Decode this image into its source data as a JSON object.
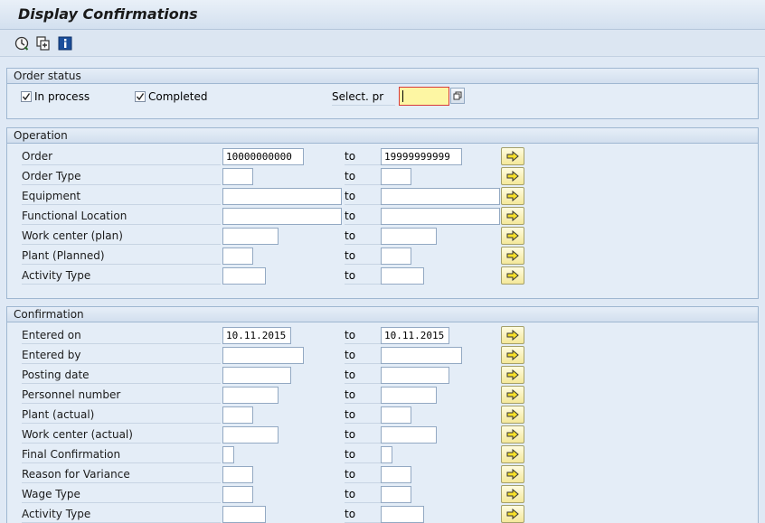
{
  "window": {
    "title": "Display Confirmations"
  },
  "toolbar": {
    "icons": [
      "execute-icon",
      "get-variant-icon",
      "info-icon"
    ]
  },
  "order_status": {
    "title": "Order status",
    "in_process": {
      "label": "In process",
      "checked": true
    },
    "completed": {
      "label": "Completed",
      "checked": true
    },
    "select_pr": {
      "label": "Select. pr",
      "value": ""
    }
  },
  "operation": {
    "title": "Operation",
    "to_label": "to",
    "rows": [
      {
        "label": "Order",
        "from": "10000000000",
        "to": "19999999999"
      },
      {
        "label": "Order Type",
        "from": "",
        "to": ""
      },
      {
        "label": "Equipment",
        "from": "",
        "to": ""
      },
      {
        "label": "Functional Location",
        "from": "",
        "to": ""
      },
      {
        "label": "Work center (plan)",
        "from": "",
        "to": ""
      },
      {
        "label": "Plant (Planned)",
        "from": "",
        "to": ""
      },
      {
        "label": "Activity Type",
        "from": "",
        "to": ""
      }
    ]
  },
  "confirmation": {
    "title": "Confirmation",
    "to_label": "to",
    "rows": [
      {
        "label": "Entered on",
        "from": "10.11.2015",
        "to": "10.11.2015"
      },
      {
        "label": "Entered by",
        "from": "",
        "to": ""
      },
      {
        "label": "Posting date",
        "from": "",
        "to": ""
      },
      {
        "label": "Personnel number",
        "from": "",
        "to": ""
      },
      {
        "label": "Plant (actual)",
        "from": "",
        "to": ""
      },
      {
        "label": "Work center (actual)",
        "from": "",
        "to": ""
      },
      {
        "label": "Final Confirmation",
        "from": "",
        "to": ""
      },
      {
        "label": "Reason for Variance",
        "from": "",
        "to": ""
      },
      {
        "label": "Wage Type",
        "from": "",
        "to": ""
      },
      {
        "label": "Activity Type",
        "from": "",
        "to": ""
      }
    ]
  }
}
